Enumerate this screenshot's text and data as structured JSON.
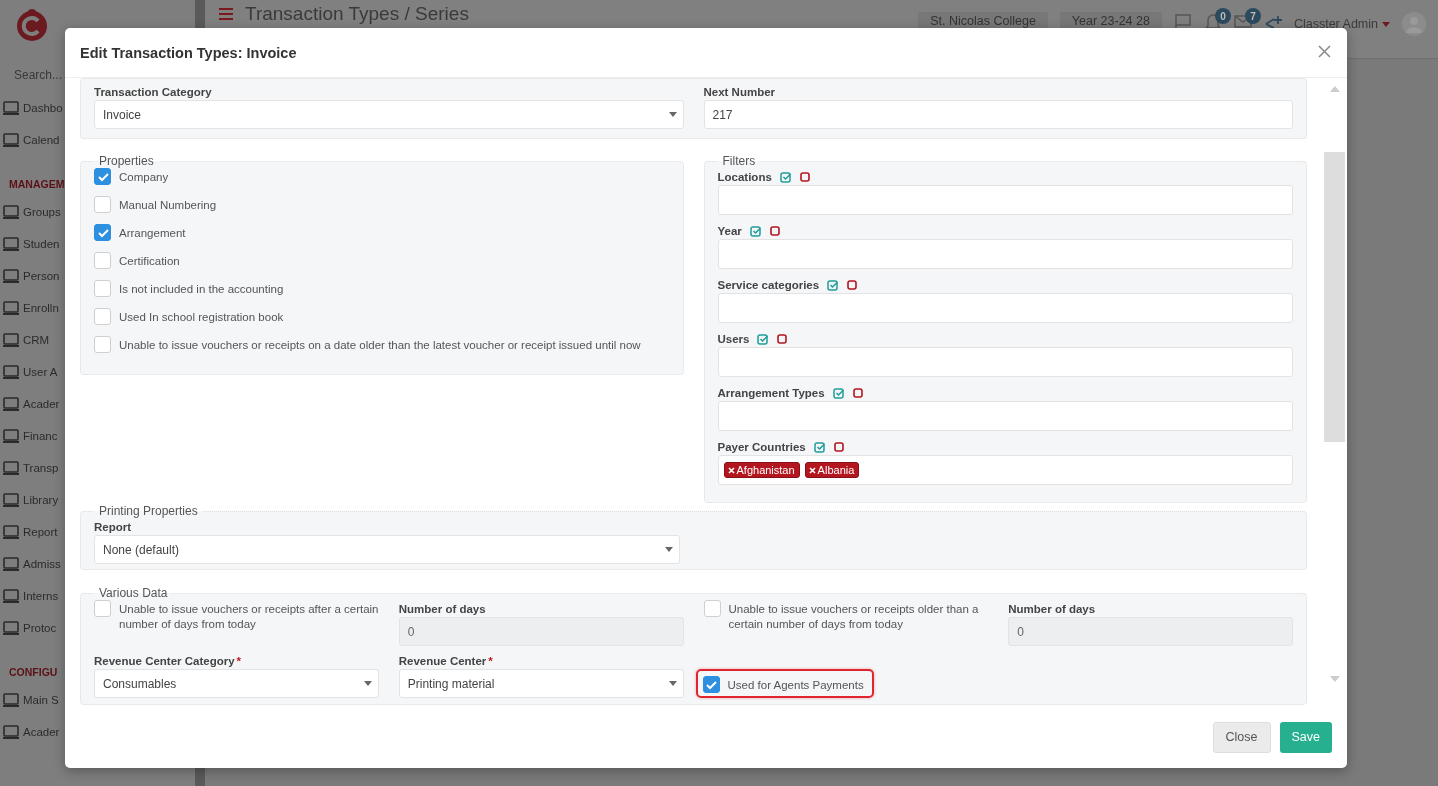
{
  "app": {
    "search_placeholder": "Search...",
    "page_title": "Transaction Types / Series",
    "school": "St. Nicolas College",
    "year": "Year 23-24 28",
    "notification_count": "0",
    "message_count": "7",
    "user": "Classter Admin"
  },
  "sidebar": {
    "items": [
      {
        "label": "Dashbo",
        "kind": "item"
      },
      {
        "label": "Calend",
        "kind": "item"
      },
      {
        "label": "MANAGEM",
        "kind": "section"
      },
      {
        "label": "Groups",
        "kind": "item"
      },
      {
        "label": "Studen",
        "kind": "item"
      },
      {
        "label": "Person",
        "kind": "item"
      },
      {
        "label": "Enrolln",
        "kind": "item"
      },
      {
        "label": "CRM",
        "kind": "item"
      },
      {
        "label": "User A",
        "kind": "item"
      },
      {
        "label": "Acader",
        "kind": "item"
      },
      {
        "label": "Financ",
        "kind": "item"
      },
      {
        "label": "Transp",
        "kind": "item"
      },
      {
        "label": "Library",
        "kind": "item"
      },
      {
        "label": "Report",
        "kind": "item"
      },
      {
        "label": "Admiss",
        "kind": "item"
      },
      {
        "label": "Interns",
        "kind": "item"
      },
      {
        "label": "Protoc",
        "kind": "item"
      },
      {
        "label": "CONFIGU",
        "kind": "section"
      },
      {
        "label": "Main S",
        "kind": "item"
      },
      {
        "label": "Acader",
        "kind": "item"
      }
    ]
  },
  "modal": {
    "title": "Edit Transaction Types: Invoice",
    "fields": [
      {
        "label": "Transaction Category",
        "value": "Invoice",
        "kind": "select"
      },
      {
        "label": "Next Number",
        "value": "217",
        "kind": "input"
      }
    ],
    "properties": {
      "legend": "Properties",
      "options": [
        {
          "label": "Company",
          "checked": true
        },
        {
          "label": "Manual Numbering",
          "checked": false
        },
        {
          "label": "Arrangement",
          "checked": true
        },
        {
          "label": "Certification",
          "checked": false
        },
        {
          "label": "Is not included in the accounting",
          "checked": false
        },
        {
          "label": "Used In school registration book",
          "checked": false
        },
        {
          "label": "Unable to issue vouchers or receipts on a date older than the latest voucher or receipt issued until now",
          "checked": false
        }
      ]
    },
    "filters": {
      "legend": "Filters",
      "items": [
        {
          "label": "Locations"
        },
        {
          "label": "Year"
        },
        {
          "label": "Service categories"
        },
        {
          "label": "Users"
        },
        {
          "label": "Arrangement Types"
        },
        {
          "label": "Payer Countries",
          "tags": [
            "Afghanistan",
            "Albania"
          ]
        }
      ]
    },
    "printing": {
      "legend": "Printing Properties",
      "label": "Report",
      "value": "None (default)"
    },
    "various": {
      "legend": "Various Data",
      "items": [
        {
          "kind": "checkbox",
          "label": "Unable to issue vouchers or receipts after a certain number of days from today",
          "checked": false,
          "highlighted": false
        },
        {
          "kind": "input",
          "label": "Number of days",
          "value": "0",
          "disabled": true
        },
        {
          "kind": "checkbox",
          "label": "Unable to issue vouchers or receipts older than a certain number of days from today",
          "checked": false,
          "highlighted": false
        },
        {
          "kind": "input",
          "label": "Number of days",
          "value": "0",
          "disabled": true
        },
        {
          "kind": "select",
          "label": "Revenue Center Category",
          "required_mark": "*",
          "value": "Consumables"
        },
        {
          "kind": "select",
          "label": "Revenue Center",
          "required_mark": "*",
          "value": "Printing material"
        },
        {
          "kind": "checkbox",
          "label": "Used for Agents Payments",
          "checked": true,
          "highlighted": true
        }
      ]
    },
    "buttons": [
      {
        "label": "Close",
        "kind": "secondary"
      },
      {
        "label": "Save",
        "kind": "primary"
      }
    ]
  }
}
